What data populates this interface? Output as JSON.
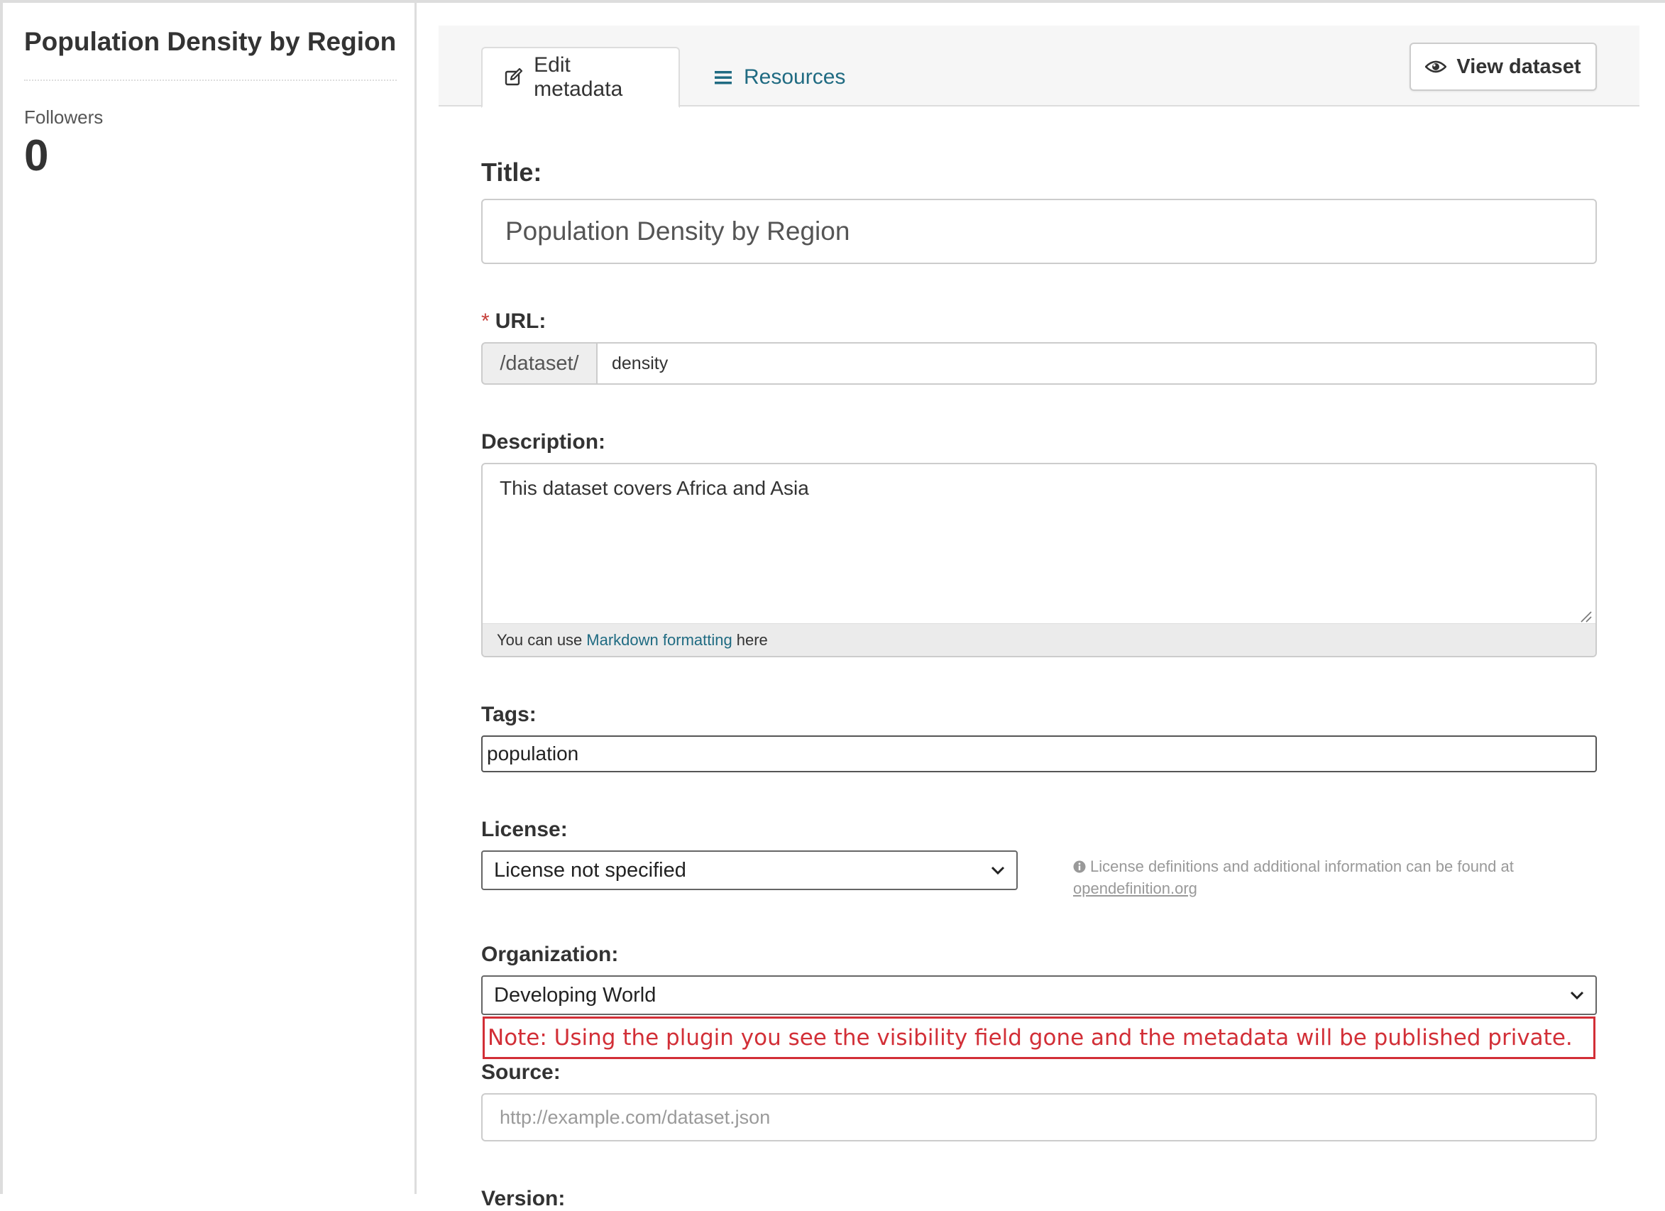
{
  "sidebar": {
    "title": "Population Density by Region",
    "followers_label": "Followers",
    "followers_count": "0"
  },
  "tabs": {
    "edit_metadata": "Edit metadata",
    "resources": "Resources",
    "view_dataset": "View dataset"
  },
  "form": {
    "title_label": "Title:",
    "title_value": "Population Density by Region",
    "url_required": "*",
    "url_label": "URL:",
    "url_prefix": "/dataset/",
    "url_value": "density",
    "description_label": "Description:",
    "description_value": "This dataset covers Africa and Asia",
    "markdown_prefix": "You can use",
    "markdown_link": "Markdown formatting",
    "markdown_suffix": "here",
    "tags_label": "Tags:",
    "tags_value": "population",
    "license_label": "License:",
    "license_value": "License not specified",
    "license_help": "License definitions and additional information can be found at",
    "license_help_link": "opendefinition.org",
    "organization_label": "Organization:",
    "organization_value": "Developing World",
    "note": "Note: Using the plugin you see the visibility field gone and the metadata will be published private.",
    "source_label": "Source:",
    "source_placeholder": "http://example.com/dataset.json",
    "next_label": "Version:"
  },
  "colors": {
    "link": "#206b82",
    "note": "#d22f37",
    "required": "#c6403b"
  }
}
